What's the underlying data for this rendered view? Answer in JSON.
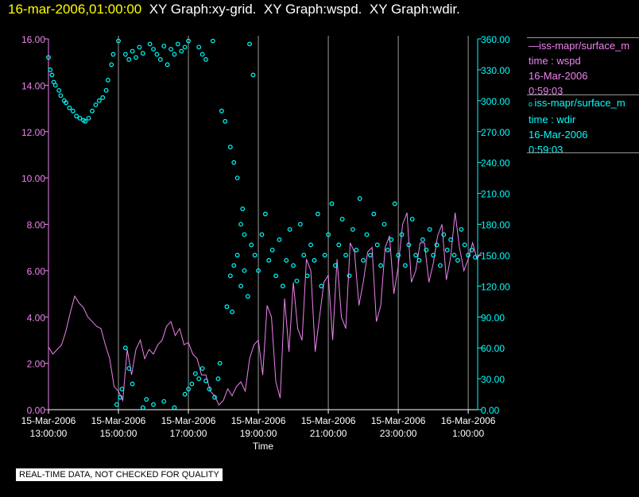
{
  "header": {
    "timestamp": "16-mar-2006,01:00:00",
    "titles": "XY Graph:xy-grid.  XY Graph:wspd.  XY Graph:wdir."
  },
  "legend": [
    {
      "name": "iss-mapr/surface_m",
      "line2": "time : wspd",
      "line3": "16-Mar-2006",
      "line4": "0:59:03",
      "color": "#ee82ee",
      "marker": "line"
    },
    {
      "name": "iss-mapr/surface_m",
      "line2": "time : wdir",
      "line3": "16-Mar-2006",
      "line4": "0:59:03",
      "color": "#00ffff",
      "marker": "circle"
    }
  ],
  "note": "REAL-TIME DATA, NOT CHECKED FOR QUALITY",
  "chart_data": {
    "type": "line",
    "xlabel": "Time",
    "x_units": "hours since 15-Mar-2006 13:00:00",
    "xlim": [
      0,
      12.27
    ],
    "x_ticks": [
      {
        "v": 0,
        "l1": "15-Mar-2006",
        "l2": "13:00:00"
      },
      {
        "v": 2,
        "l1": "15-Mar-2006",
        "l2": "15:00:00"
      },
      {
        "v": 4,
        "l1": "15-Mar-2006",
        "l2": "17:00:00"
      },
      {
        "v": 6,
        "l1": "15-Mar-2006",
        "l2": "19:00:00"
      },
      {
        "v": 8,
        "l1": "15-Mar-2006",
        "l2": "21:00:00"
      },
      {
        "v": 10,
        "l1": "15-Mar-2006",
        "l2": "23:00:00"
      },
      {
        "v": 12,
        "l1": "16-Mar-2006",
        "l2": "1:00:00"
      }
    ],
    "y_left": {
      "ylim": [
        0,
        16
      ],
      "ticks": [
        "0.00",
        "2.00",
        "4.00",
        "6.00",
        "8.00",
        "10.00",
        "12.00",
        "14.00",
        "16.00"
      ],
      "color": "#ee82ee"
    },
    "y_right": {
      "ylim": [
        0,
        360
      ],
      "ticks": [
        "0.00",
        "30.00",
        "60.00",
        "90.00",
        "120.00",
        "150.00",
        "180.00",
        "210.00",
        "240.00",
        "270.00",
        "300.00",
        "330.00",
        "360.00"
      ],
      "color": "#00ffff"
    },
    "grid": "vertical",
    "series": [
      {
        "name": "wspd",
        "axis": "left",
        "type": "line",
        "color": "#ee82ee",
        "dx": 0.125,
        "values": [
          2.7,
          2.4,
          2.6,
          2.8,
          3.4,
          4.2,
          4.9,
          4.6,
          4.4,
          4.0,
          3.8,
          3.6,
          3.5,
          2.8,
          2.2,
          1.0,
          0.8,
          0.4,
          2.6,
          1.5,
          2.6,
          3.0,
          2.2,
          2.6,
          2.4,
          2.8,
          3.0,
          3.6,
          3.8,
          3.2,
          3.5,
          2.8,
          2.9,
          2.4,
          2.2,
          1.5,
          1.5,
          0.8,
          0.6,
          0.2,
          0.4,
          0.9,
          0.6,
          1.0,
          1.2,
          0.8,
          2.2,
          2.8,
          3.0,
          1.5,
          4.5,
          4.0,
          1.2,
          0.5,
          4.8,
          2.5,
          5.5,
          3.5,
          3.0,
          6.5,
          6.0,
          2.5,
          4.0,
          5.5,
          5.8,
          3.0,
          6.5,
          4.0,
          3.5,
          7.2,
          6.8,
          4.5,
          5.5,
          6.8,
          7.0,
          3.8,
          4.5,
          7.0,
          7.5,
          5.0,
          6.2,
          8.0,
          8.5,
          5.5,
          6.0,
          7.2,
          7.2,
          5.5,
          6.3,
          7.5,
          8.0,
          5.6,
          6.6,
          8.5,
          7.0,
          6.0,
          6.5,
          7.2,
          6.5,
          6.8
        ]
      },
      {
        "name": "wdir",
        "axis": "right",
        "type": "scatter",
        "color": "#00ffff",
        "points": [
          [
            0,
            342
          ],
          [
            0.05,
            330
          ],
          [
            0.1,
            325
          ],
          [
            0.15,
            318
          ],
          [
            0.2,
            315
          ],
          [
            0.3,
            310
          ],
          [
            0.35,
            305
          ],
          [
            0.45,
            300
          ],
          [
            0.5,
            298
          ],
          [
            0.6,
            293
          ],
          [
            0.7,
            290
          ],
          [
            0.8,
            285
          ],
          [
            0.9,
            283
          ],
          [
            1.0,
            281
          ],
          [
            1.05,
            280
          ],
          [
            1.15,
            283
          ],
          [
            1.25,
            290
          ],
          [
            1.35,
            296
          ],
          [
            1.45,
            300
          ],
          [
            1.55,
            303
          ],
          [
            1.65,
            310
          ],
          [
            1.7,
            320
          ],
          [
            1.8,
            335
          ],
          [
            1.85,
            345
          ],
          [
            2.0,
            358
          ],
          [
            2.2,
            345
          ],
          [
            2.3,
            340
          ],
          [
            2.4,
            348
          ],
          [
            2.5,
            342
          ],
          [
            2.6,
            352
          ],
          [
            2.7,
            346
          ],
          [
            2.9,
            355
          ],
          [
            3.0,
            350
          ],
          [
            3.1,
            345
          ],
          [
            3.2,
            340
          ],
          [
            3.3,
            353
          ],
          [
            3.4,
            335
          ],
          [
            3.5,
            350
          ],
          [
            3.6,
            345
          ],
          [
            3.7,
            355
          ],
          [
            3.8,
            348
          ],
          [
            3.9,
            352
          ],
          [
            4.0,
            358
          ],
          [
            4.3,
            352
          ],
          [
            4.4,
            345
          ],
          [
            4.5,
            340
          ],
          [
            4.7,
            358
          ],
          [
            1.95,
            5
          ],
          [
            2.05,
            12
          ],
          [
            2.1,
            20
          ],
          [
            2.2,
            60
          ],
          [
            2.3,
            40
          ],
          [
            2.4,
            25
          ],
          [
            2.7,
            2
          ],
          [
            2.8,
            10
          ],
          [
            3.0,
            5
          ],
          [
            3.3,
            8
          ],
          [
            3.6,
            2
          ],
          [
            3.9,
            15
          ],
          [
            4.0,
            20
          ],
          [
            4.1,
            25
          ],
          [
            4.2,
            35
          ],
          [
            4.3,
            30
          ],
          [
            4.4,
            40
          ],
          [
            4.5,
            28
          ],
          [
            4.6,
            20
          ],
          [
            4.75,
            12
          ],
          [
            4.85,
            30
          ],
          [
            4.9,
            45
          ],
          [
            4.95,
            290
          ],
          [
            5.05,
            280
          ],
          [
            5.2,
            255
          ],
          [
            5.3,
            240
          ],
          [
            5.4,
            225
          ],
          [
            5.5,
            180
          ],
          [
            5.55,
            195
          ],
          [
            5.6,
            170
          ],
          [
            5.2,
            130
          ],
          [
            5.3,
            140
          ],
          [
            5.4,
            150
          ],
          [
            5.5,
            120
          ],
          [
            5.6,
            135
          ],
          [
            5.7,
            110
          ],
          [
            5.8,
            160
          ],
          [
            5.9,
            150
          ],
          [
            6.0,
            135
          ],
          [
            6.1,
            170
          ],
          [
            6.2,
            190
          ],
          [
            5.75,
            355
          ],
          [
            5.85,
            325
          ],
          [
            5.1,
            100
          ],
          [
            5.25,
            95
          ],
          [
            6.3,
            145
          ],
          [
            6.4,
            155
          ],
          [
            6.5,
            130
          ],
          [
            6.6,
            165
          ],
          [
            6.7,
            120
          ],
          [
            6.8,
            145
          ],
          [
            6.9,
            175
          ],
          [
            7.0,
            140
          ],
          [
            7.1,
            125
          ],
          [
            7.2,
            180
          ],
          [
            7.3,
            150
          ],
          [
            7.4,
            130
          ],
          [
            7.5,
            160
          ],
          [
            7.6,
            145
          ],
          [
            7.7,
            190
          ],
          [
            7.8,
            120
          ],
          [
            7.9,
            150
          ],
          [
            8.0,
            170
          ],
          [
            8.1,
            200
          ],
          [
            8.2,
            140
          ],
          [
            8.3,
            160
          ],
          [
            8.4,
            185
          ],
          [
            8.5,
            150
          ],
          [
            8.6,
            130
          ],
          [
            8.7,
            175
          ],
          [
            8.8,
            155
          ],
          [
            8.9,
            205
          ],
          [
            9.0,
            145
          ],
          [
            9.1,
            170
          ],
          [
            9.2,
            150
          ],
          [
            9.3,
            190
          ],
          [
            9.4,
            160
          ],
          [
            9.5,
            140
          ],
          [
            9.6,
            180
          ],
          [
            9.7,
            155
          ],
          [
            9.8,
            165
          ],
          [
            9.9,
            200
          ],
          [
            10.0,
            150
          ],
          [
            10.1,
            170
          ],
          [
            10.2,
            140
          ],
          [
            10.3,
            160
          ],
          [
            10.4,
            185
          ],
          [
            10.5,
            150
          ],
          [
            10.6,
            145
          ],
          [
            10.7,
            165
          ],
          [
            10.8,
            155
          ],
          [
            10.9,
            175
          ],
          [
            11.0,
            150
          ],
          [
            11.1,
            160
          ],
          [
            11.2,
            140
          ],
          [
            11.3,
            170
          ],
          [
            11.4,
            155
          ],
          [
            11.5,
            165
          ],
          [
            11.6,
            150
          ],
          [
            11.7,
            145
          ],
          [
            11.8,
            175
          ],
          [
            11.9,
            160
          ],
          [
            12.0,
            150
          ],
          [
            12.1,
            155
          ],
          [
            12.2,
            148
          ]
        ]
      }
    ]
  }
}
